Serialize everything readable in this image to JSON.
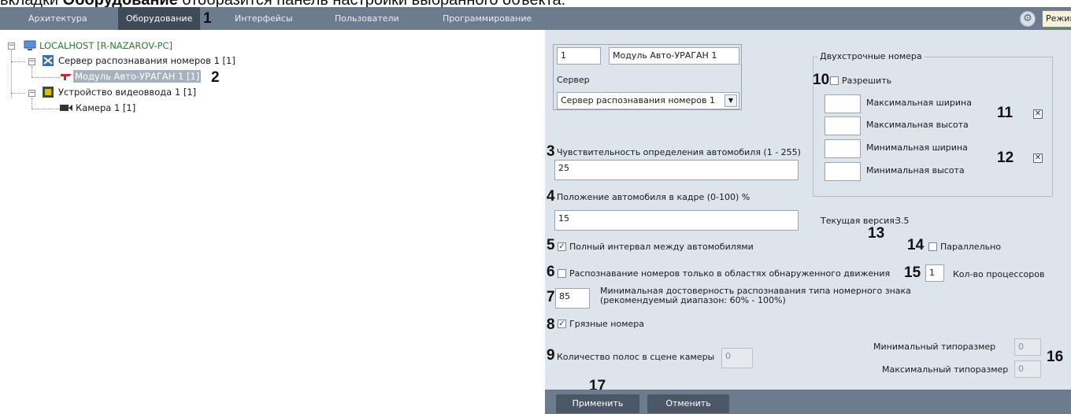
{
  "caption": {
    "prefix": "вкладки",
    "bold": "Оборудование",
    "suffix": "отобразится панель настройки выбранного объекта."
  },
  "topbar": {
    "tabs": [
      {
        "label": "Архитектура"
      },
      {
        "label": "Оборудование"
      },
      {
        "label": "Интерфейсы"
      },
      {
        "label": "Пользователи"
      },
      {
        "label": "Программирование"
      }
    ],
    "mode_label": "Режим"
  },
  "tree": {
    "root": "LOCALHOST [R-NAZAROV-PC]",
    "server": "Сервер распознавания номеров 1 [1]",
    "module": "Модуль Авто-УРАГАН 1 [1]",
    "device": "Устройство видеоввода 1 [1]",
    "camera": "Камера 1 [1]"
  },
  "numbers": {
    "n1": "1",
    "n2": "2",
    "n3": "3",
    "n4": "4",
    "n5": "5",
    "n6": "6",
    "n7": "7",
    "n8": "8",
    "n9": "9",
    "n10": "10",
    "n11": "11",
    "n12": "12",
    "n13": "13",
    "n14": "14",
    "n15": "15",
    "n16": "16",
    "n17": "17"
  },
  "panel": {
    "id_value": "1",
    "name_value": "Модуль Авто-УРАГАН 1",
    "server_label": "Сервер",
    "server_value": "Сервер распознавания номеров 1",
    "sensitivity_label": "Чувствительность определения автомобиля (1 - 255)",
    "sensitivity_value": "25",
    "position_label": "Положение автомобиля в кадре (0-100) %",
    "position_value": "15",
    "full_interval_label": "Полный интервал между автомобилями",
    "motion_only_label": "Распознавание номеров только в областях обнаруженного движения",
    "confidence_value": "85",
    "confidence_label_line1": "Минимальная достоверность распознавания типа номерного знака",
    "confidence_label_line2": "(рекомендуемый диапазон: 60% - 100%)",
    "dirty_label": "Грязные номера",
    "lanes_label": "Количество полос в сцене камеры",
    "lanes_value": "0",
    "two_line_group_title": "Двухстрочные номера",
    "allow_label": "Разрешить",
    "max_width_label": "Максимальная ширина",
    "max_height_label": "Максимальная высота",
    "min_width_label": "Минимальная ширина",
    "min_height_label": "Минимальная высота",
    "version_label": "Текущая версия:",
    "version_value": "3.5",
    "parallel_label": "Параллельно",
    "processors_value": "1",
    "processors_label": "Кол-во процессоров",
    "min_size_label": "Минимальный типоразмер",
    "min_size_value": "0",
    "max_size_label": "Максимальный типоразмер",
    "max_size_value": "0",
    "check_mark": "✓",
    "x_mark": "✕"
  },
  "buttons": {
    "apply": "Применить",
    "cancel": "Отменить"
  },
  "icons": {
    "gear": "settings-icon",
    "computer": "computer-icon",
    "server": "server-icon",
    "module": "module-icon",
    "device": "video-device-icon",
    "camera": "camera-icon"
  },
  "colors": {
    "topbar": "#6c7b8d",
    "active_tab": "#3f4a57",
    "panel": "#dde4ec",
    "root_text": "#2e7d32"
  }
}
